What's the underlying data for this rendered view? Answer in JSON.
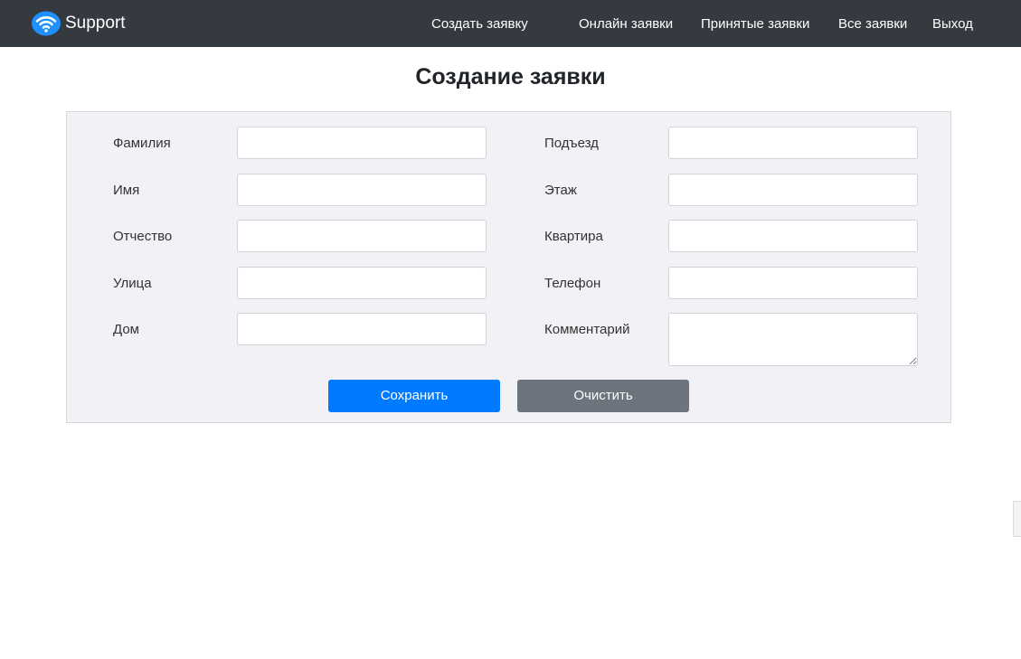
{
  "brand": {
    "name": "Support",
    "logo_icon": "wifi-icon",
    "logo_color": "#1e90ff"
  },
  "nav": {
    "items": [
      {
        "label": "Создать заявку"
      },
      {
        "label": "Онлайн заявки"
      },
      {
        "label": "Принятые заявки"
      },
      {
        "label": "Все заявки"
      },
      {
        "label": "Выход"
      }
    ]
  },
  "page": {
    "title": "Создание заявки"
  },
  "form": {
    "left_fields": [
      {
        "label": "Фамилия",
        "value": ""
      },
      {
        "label": "Имя",
        "value": ""
      },
      {
        "label": "Отчество",
        "value": ""
      },
      {
        "label": "Улица",
        "value": ""
      },
      {
        "label": "Дом",
        "value": ""
      }
    ],
    "right_fields": [
      {
        "label": "Подъезд",
        "value": ""
      },
      {
        "label": "Этаж",
        "value": ""
      },
      {
        "label": "Квартира",
        "value": ""
      },
      {
        "label": "Телефон",
        "value": ""
      },
      {
        "label": "Комментарий",
        "value": ""
      }
    ],
    "save_label": "Сохранить",
    "clear_label": "Очистить"
  },
  "colors": {
    "navbar_bg": "#343a40",
    "panel_bg": "#f2f2f6",
    "save_button": "#007bff",
    "clear_button": "#6c757d"
  }
}
